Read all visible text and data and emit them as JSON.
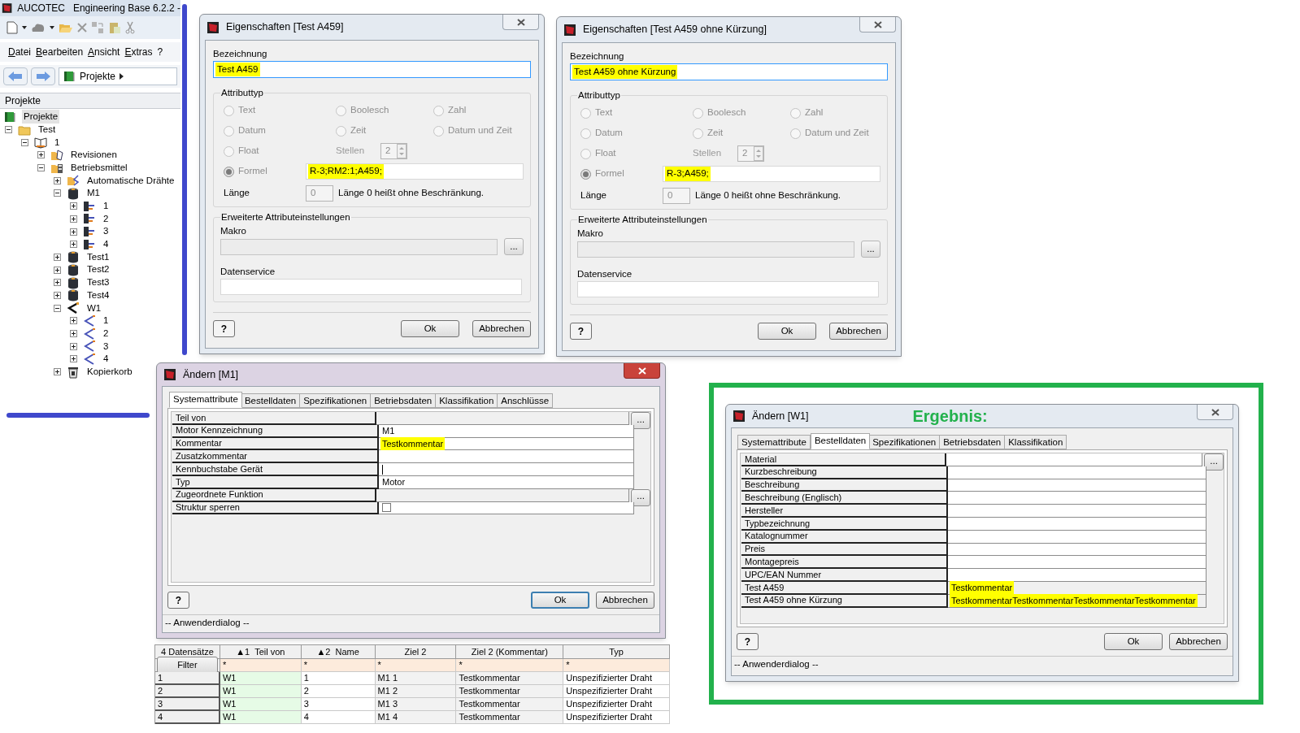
{
  "app": {
    "brand": "AUCOTEC",
    "title": "Engineering Base 6.2.2 -",
    "menu": [
      "Datei",
      "Bearbeiten",
      "Ansicht",
      "Extras",
      "?"
    ],
    "breadcrumb": "Projekte",
    "panel_title": "Projekte",
    "tree": [
      {
        "label": "Projekte",
        "kind": "project",
        "selected": true,
        "children": [
          {
            "label": "Test",
            "kind": "folder",
            "selected": false,
            "expanded": true,
            "children": [
              {
                "label": "1",
                "kind": "book",
                "selected": false,
                "expanded": true,
                "children": [
                  {
                    "label": "Revisionen",
                    "kind": "revisions",
                    "selected": false,
                    "expanded": false
                  },
                  {
                    "label": "Betriebsmittel",
                    "kind": "equipment",
                    "selected": false,
                    "expanded": true,
                    "children": [
                      {
                        "label": "Automatische Drähte",
                        "kind": "wirefolder",
                        "selected": false,
                        "expanded": false
                      },
                      {
                        "label": "M1",
                        "kind": "motor",
                        "selected": false,
                        "expanded": true,
                        "children": [
                          {
                            "label": "1",
                            "kind": "plug",
                            "selected": false,
                            "expanded": false
                          },
                          {
                            "label": "2",
                            "kind": "plug",
                            "selected": false,
                            "expanded": false
                          },
                          {
                            "label": "3",
                            "kind": "plug",
                            "selected": false,
                            "expanded": false
                          },
                          {
                            "label": "4",
                            "kind": "plug",
                            "selected": false,
                            "expanded": false
                          }
                        ]
                      },
                      {
                        "label": "Test1",
                        "kind": "motor",
                        "selected": false,
                        "expanded": false
                      },
                      {
                        "label": "Test2",
                        "kind": "motor",
                        "selected": false,
                        "expanded": false
                      },
                      {
                        "label": "Test3",
                        "kind": "motor",
                        "selected": false,
                        "expanded": false
                      },
                      {
                        "label": "Test4",
                        "kind": "motor",
                        "selected": false,
                        "expanded": false
                      },
                      {
                        "label": "W1",
                        "kind": "cable",
                        "selected": false,
                        "expanded": true,
                        "children": [
                          {
                            "label": "1",
                            "kind": "wire",
                            "selected": false,
                            "expanded": false
                          },
                          {
                            "label": "2",
                            "kind": "wire",
                            "selected": false,
                            "expanded": false
                          },
                          {
                            "label": "3",
                            "kind": "wire",
                            "selected": false,
                            "expanded": false
                          },
                          {
                            "label": "4",
                            "kind": "wire",
                            "selected": false,
                            "expanded": false
                          }
                        ]
                      },
                      {
                        "label": "Kopierkorb",
                        "kind": "basket",
                        "selected": false,
                        "expanded": false
                      }
                    ]
                  }
                ]
              }
            ]
          }
        ]
      }
    ]
  },
  "properties_dialogs": [
    {
      "title": "Eigenschaften [Test A459]",
      "name_label": "Bezeichnung",
      "name": {
        "value": "Test A459",
        "highlighted": true
      },
      "type_label": "Attributtyp",
      "disabled": true,
      "types": [
        {
          "label": "Text",
          "selected": false
        },
        {
          "label": "Boolesch",
          "selected": false
        },
        {
          "label": "Zahl",
          "selected": false
        },
        {
          "label": "Datum",
          "selected": false
        },
        {
          "label": "Zeit",
          "selected": false
        },
        {
          "label": "Datum und Zeit",
          "selected": false
        },
        {
          "label": "Float",
          "selected": false
        },
        {
          "label": "Formel",
          "selected": true
        }
      ],
      "digits_label": "Stellen",
      "digits": "2",
      "formula": {
        "value": "R-3;RM2:1;A459;",
        "highlighted": true
      },
      "length_label": "Länge",
      "length": "0",
      "length_hint": "Länge 0 heißt ohne Beschränkung.",
      "advanced_label": "Erweiterte Attributeinstellungen",
      "macro_label": "Makro",
      "macro_button": "...",
      "data_service_label": "Datenservice",
      "help": "?",
      "ok": "Ok",
      "cancel": "Abbrechen"
    },
    {
      "title": "Eigenschaften [Test A459 ohne Kürzung]",
      "name_label": "Bezeichnung",
      "name": {
        "value": "Test A459 ohne Kürzung",
        "highlighted": true
      },
      "type_label": "Attributtyp",
      "disabled": true,
      "types": [
        {
          "label": "Text",
          "selected": false
        },
        {
          "label": "Boolesch",
          "selected": false
        },
        {
          "label": "Zahl",
          "selected": false
        },
        {
          "label": "Datum",
          "selected": false
        },
        {
          "label": "Zeit",
          "selected": false
        },
        {
          "label": "Datum und Zeit",
          "selected": false
        },
        {
          "label": "Float",
          "selected": false
        },
        {
          "label": "Formel",
          "selected": true
        }
      ],
      "digits_label": "Stellen",
      "digits": "2",
      "formula": {
        "value": "R-3;A459;",
        "highlighted": true
      },
      "length_label": "Länge",
      "length": "0",
      "length_hint": "Länge 0 heißt ohne Beschränkung.",
      "advanced_label": "Erweiterte Attributeinstellungen",
      "macro_label": "Makro",
      "macro_button": "...",
      "data_service_label": "Datenservice",
      "help": "?",
      "ok": "Ok",
      "cancel": "Abbrechen"
    }
  ],
  "edit_dialogs": [
    {
      "title": "Ändern [M1]",
      "active": true,
      "tabs": [
        {
          "label": "Systemattribute",
          "selected": true
        },
        {
          "label": "Bestelldaten",
          "selected": false
        },
        {
          "label": "Spezifikationen",
          "selected": false
        },
        {
          "label": "Betriebsdaten",
          "selected": false
        },
        {
          "label": "Klassifikation",
          "selected": false
        },
        {
          "label": "Anschlüsse",
          "selected": false
        }
      ],
      "rows": [
        {
          "label": "Teil von",
          "kind": "picker",
          "readonly": true,
          "button": "..."
        },
        {
          "label": "Motor Kennzeichnung",
          "kind": "text",
          "value": "M1",
          "readonly": false,
          "highlighted": false
        },
        {
          "label": "Kommentar",
          "kind": "text",
          "value": "Testkommentar",
          "readonly": false,
          "highlighted": true
        },
        {
          "label": "Zusatzkommentar",
          "kind": "text",
          "readonly": false
        },
        {
          "label": "Kennbuchstabe Gerät",
          "kind": "text",
          "readonly": false,
          "focused": true
        },
        {
          "label": "Typ",
          "kind": "text",
          "value": "Motor",
          "readonly": false,
          "highlighted": false
        },
        {
          "label": "Zugeordnete Funktion",
          "kind": "picker",
          "readonly": true,
          "button": "..."
        },
        {
          "label": "Struktur sperren",
          "kind": "checkbox",
          "checked": false
        }
      ],
      "help": "?",
      "ok": "Ok",
      "ok_default": true,
      "cancel": "Abbrechen",
      "status": "-- Anwenderdialog --"
    },
    {
      "title": "Ändern [W1]",
      "heading": "Ergebnis:",
      "active": false,
      "tabs": [
        {
          "label": "Systemattribute",
          "selected": false
        },
        {
          "label": "Bestelldaten",
          "selected": true
        },
        {
          "label": "Spezifikationen",
          "selected": false
        },
        {
          "label": "Betriebsdaten",
          "selected": false
        },
        {
          "label": "Klassifikation",
          "selected": false
        }
      ],
      "rows": [
        {
          "label": "Material",
          "kind": "picker",
          "readonly": false,
          "button": "..."
        },
        {
          "label": "Kurzbeschreibung",
          "kind": "text",
          "readonly": false
        },
        {
          "label": "Beschreibung",
          "kind": "text",
          "readonly": false
        },
        {
          "label": "Beschreibung (Englisch)",
          "kind": "text",
          "readonly": false
        },
        {
          "label": "Hersteller",
          "kind": "text",
          "readonly": false
        },
        {
          "label": "Typbezeichnung",
          "kind": "text",
          "readonly": false
        },
        {
          "label": "Katalognummer",
          "kind": "text",
          "readonly": false
        },
        {
          "label": "Preis",
          "kind": "text",
          "readonly": false
        },
        {
          "label": "Montagepreis",
          "kind": "text",
          "readonly": false
        },
        {
          "label": "UPC/EAN Nummer",
          "kind": "text",
          "readonly": false
        },
        {
          "label": "Test A459",
          "kind": "text",
          "value": "Testkommentar",
          "readonly": true,
          "highlighted": true
        },
        {
          "label": "Test A459 ohne Kürzung",
          "kind": "text",
          "value": "TestkommentarTestkommentarTestkommentarTestkommentar",
          "readonly": true,
          "highlighted": true
        }
      ],
      "help": "?",
      "ok": "Ok",
      "ok_default": false,
      "cancel": "Abbrechen",
      "status": "-- Anwenderdialog --"
    }
  ],
  "records_table": {
    "count": "4 Datensätze",
    "filter_button": "Filter",
    "columns": [
      {
        "sort": "▲1",
        "label": "Teil von",
        "kind": "key"
      },
      {
        "sort": "▲2",
        "label": "Name",
        "kind": "plain"
      },
      {
        "label": "Ziel 2",
        "kind": "readonly"
      },
      {
        "label": "Ziel 2 (Kommentar)",
        "kind": "readonly"
      },
      {
        "label": "Typ",
        "kind": "plain"
      }
    ],
    "filters": [
      "*",
      "*",
      "*",
      "*",
      "*"
    ],
    "rows": [
      {
        "index": "1",
        "cells": [
          "W1",
          "1",
          "M1 1",
          "Testkommentar",
          "Unspezifizierter Draht"
        ]
      },
      {
        "index": "2",
        "cells": [
          "W1",
          "2",
          "M1 2",
          "Testkommentar",
          "Unspezifizierter Draht"
        ]
      },
      {
        "index": "3",
        "cells": [
          "W1",
          "3",
          "M1 3",
          "Testkommentar",
          "Unspezifizierter Draht"
        ]
      },
      {
        "index": "4",
        "cells": [
          "W1",
          "4",
          "M1 4",
          "Testkommentar",
          "Unspezifizierter Draht"
        ]
      }
    ]
  }
}
